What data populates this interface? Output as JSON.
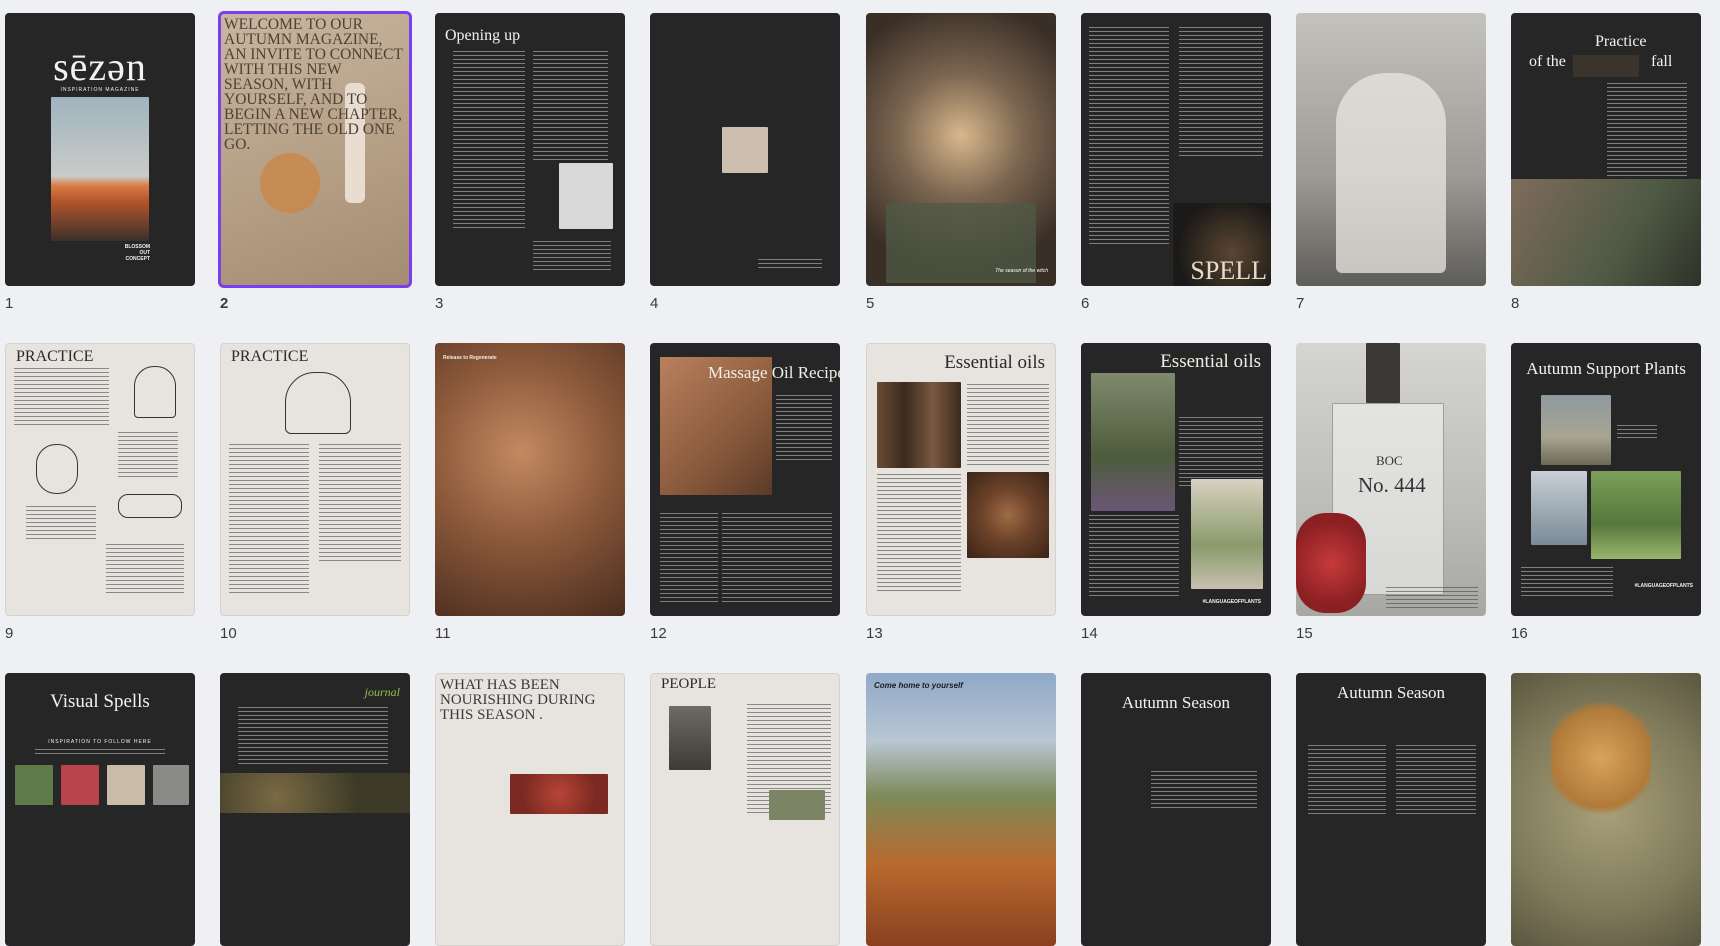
{
  "pages": [
    {
      "num": "1",
      "logo": "sēzən",
      "subtitle": "INSPIRATION MAGAZINE",
      "tagline": "BLOSSOM OUT CONCEPT"
    },
    {
      "num": "2",
      "title": "WELCOME TO OUR AUTUMN MAGAZINE, AN INVITE TO CONNECT WITH THIS NEW SEASON, WITH YOURSELF, AND TO BEGIN A NEW CHAPTER, LETTING THE OLD ONE GO."
    },
    {
      "num": "3",
      "title": "Opening up"
    },
    {
      "num": "4"
    },
    {
      "num": "5",
      "caption": "The season of the witch"
    },
    {
      "num": "6",
      "word": "SPELL"
    },
    {
      "num": "7"
    },
    {
      "num": "8",
      "title_a": "Practice",
      "title_b": "of the",
      "title_c": "fall"
    },
    {
      "num": "9",
      "title": "PRACTICE"
    },
    {
      "num": "10",
      "title": "PRACTICE"
    },
    {
      "num": "11",
      "caption": "Release to Regenerate"
    },
    {
      "num": "12",
      "title": "Massage Oil Recipe"
    },
    {
      "num": "13",
      "title": "Essential oils"
    },
    {
      "num": "14",
      "title": "Essential oils",
      "tag": "#LANGUAGEOFPLANTS"
    },
    {
      "num": "15",
      "label_a": "BOC",
      "label_b": "No. 444"
    },
    {
      "num": "16",
      "title": "Autumn Support Plants",
      "tag": "#LANGUAGEOFPLANTS"
    },
    {
      "num": "",
      "title": "Visual Spells",
      "sub": "INSPIRATION TO FOLLOW HERE"
    },
    {
      "num": "",
      "title": "journal"
    },
    {
      "num": "",
      "title": "WHAT HAS BEEN NOURISHING DURING THIS SEASON ."
    },
    {
      "num": "",
      "title": "PEOPLE"
    },
    {
      "num": "",
      "title": "Come home to yourself"
    },
    {
      "num": "",
      "title": "Autumn Season"
    },
    {
      "num": "",
      "title": "Autumn Season"
    },
    {
      "num": ""
    }
  ],
  "selected_page": "2",
  "colors": {
    "accent": "#7a3ef0",
    "dark_page": "#262626",
    "light_page": "#e7e4df"
  }
}
